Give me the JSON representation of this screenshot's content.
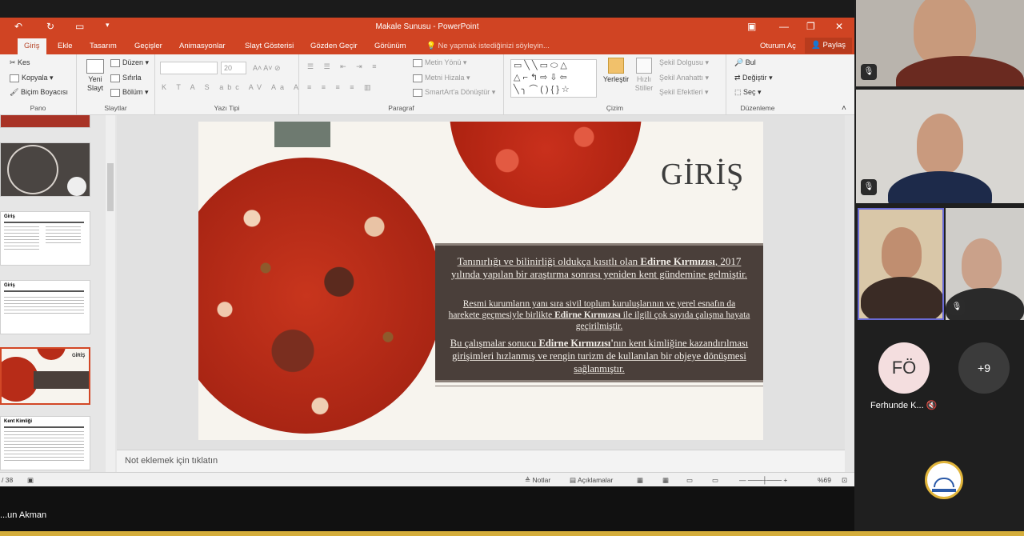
{
  "window": {
    "title": "Makale Sunusu - PowerPoint"
  },
  "tabs": [
    "Giriş",
    "Ekle",
    "Tasarım",
    "Geçişler",
    "Animasyonlar",
    "Slayt Gösterisi",
    "Gözden Geçir",
    "Görünüm"
  ],
  "active_tab": "Giriş",
  "tell_me": "Ne yapmak istediğinizi söyleyin...",
  "sign_in": "Oturum Aç",
  "share": "Paylaş",
  "ribbon": {
    "clipboard": {
      "cut": "Kes",
      "copy": "Kopyala",
      "format_painter": "Biçim Boyacısı",
      "label": "Pano"
    },
    "slides": {
      "new_slide_l1": "Yeni",
      "new_slide_l2": "Slayt",
      "layout": "Düzen",
      "reset": "Sıfırla",
      "section": "Bölüm",
      "label": "Slaytlar"
    },
    "font": {
      "label": "Yazı Tipi",
      "size": "20"
    },
    "paragraph": {
      "text_direction": "Metin Yönü",
      "align_text": "Metni Hizala",
      "smartart": "SmartArt'a Dönüştür",
      "label": "Paragraf"
    },
    "drawing": {
      "arrange": "Yerleştir",
      "quick_styles_l1": "Hızlı",
      "quick_styles_l2": "Stiller",
      "shape_fill": "Şekil Dolgusu",
      "shape_outline": "Şekil Anahattı",
      "shape_effects": "Şekil Efektleri",
      "label": "Çizim"
    },
    "editing": {
      "find": "Bul",
      "replace": "Değiştir",
      "select": "Seç",
      "label": "Düzenleme"
    }
  },
  "thumbnails": {
    "t3_title": "Giriş",
    "t4_title": "Giriş",
    "t5_title": "GİRİŞ",
    "t6_title": "Kent Kimliği"
  },
  "slide": {
    "title": "GİRİŞ",
    "p1_a": "Tanınırlığı ve bilinirliği oldukça kısıtlı olan ",
    "p1_b": "Edirne Kırmızısı",
    "p1_c": ", 2017 yılında yapılan bir araştırma sonrası yeniden kent gündemine gelmiştir.",
    "p2_a": "Resmi kurumların yanı sıra sivil toplum kuruluşlarının ve yerel esnafın da harekete geçmesiyle birlikte ",
    "p2_b": "Edirne Kırmızısı",
    "p2_c": " ile ilgili çok sayıda çalışma hayata geçirilmiştir.",
    "p3_a": "Bu çalışmalar sonucu ",
    "p3_b": "Edirne Kırmızısı'",
    "p3_c": "nın kent kimliğine kazandırılması girişimleri hızlanmış ve rengin turizm de kullanılan bir objeye dönüşmesi sağlanmıştır."
  },
  "notes_placeholder": "Not eklemek için tıklatın",
  "status": {
    "slide_count": "/ 38",
    "notes": "Notlar",
    "comments": "Açıklamalar",
    "zoom": "%69"
  },
  "presenter_name": "...un Akman",
  "participants": {
    "initials": "FÖ",
    "name": "Ferhunde K...",
    "more": "+9"
  },
  "colors": {
    "ppt_accent": "#d04423",
    "active_speaker": "#6a6bd6"
  }
}
